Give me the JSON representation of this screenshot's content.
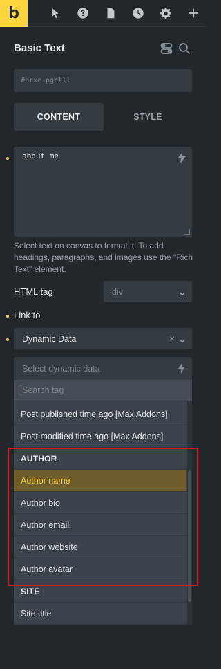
{
  "topbar": {
    "logo": "b",
    "icons": [
      "pointer-icon",
      "help-icon",
      "pages-icon",
      "history-icon",
      "settings-icon",
      "add-icon"
    ]
  },
  "panel": {
    "title": "Basic Text",
    "element_id": "#brxe-pgclll"
  },
  "tabs": {
    "content": "CONTENT",
    "style": "STYLE"
  },
  "text_editor": {
    "value": "about me",
    "help": "Select text on canvas to format it. To add headings, paragraphs, and images use the \"Rich Text\" element."
  },
  "html_tag": {
    "label": "HTML tag",
    "value": "div"
  },
  "link": {
    "label": "Link to",
    "type_value": "Dynamic Data",
    "clear_symbol": "×"
  },
  "dynamic_data": {
    "placeholder": "Select dynamic data",
    "search_placeholder": "Search tag",
    "options": [
      {
        "label": "Post published time ago [Max Addons]"
      },
      {
        "label": "Post modified time ago [Max Addons]"
      },
      {
        "label": "AUTHOR",
        "group": true
      },
      {
        "label": "Author name",
        "active": true
      },
      {
        "label": "Author bio"
      },
      {
        "label": "Author email"
      },
      {
        "label": "Author website"
      },
      {
        "label": "Author avatar"
      },
      {
        "label": "SITE",
        "group": true
      },
      {
        "label": "Site title"
      }
    ]
  },
  "colors": {
    "accent": "#ffd53e",
    "highlight_box": "#e0161d"
  }
}
